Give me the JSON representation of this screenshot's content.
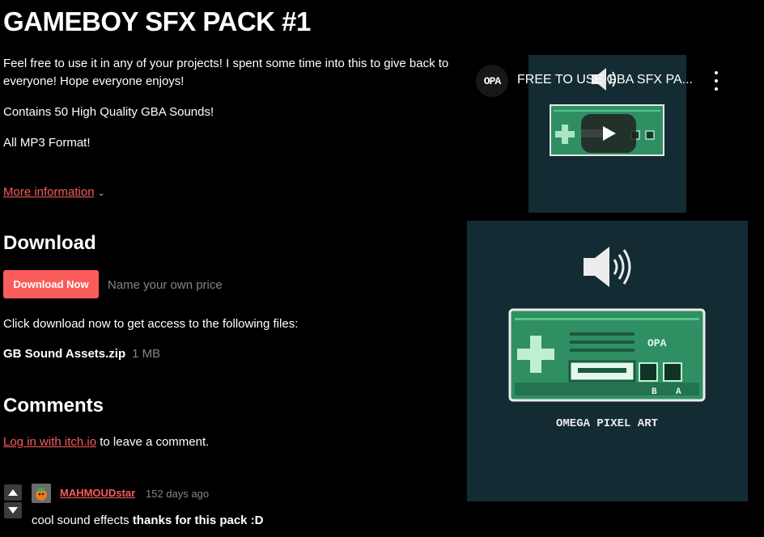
{
  "page": {
    "title": "GAMEBOY SFX PACK #1",
    "description": [
      "Feel free to use it in any of your projects! I spent some time into this to give back to everyone!  Hope everyone enjoys!",
      "Contains 50 High Quality GBA Sounds!",
      "All MP3 Format!"
    ],
    "more_info": "More information"
  },
  "download": {
    "heading": "Download",
    "button_label": "Download Now",
    "price_hint": "Name your own price",
    "files_intro": "Click download now to get access to the following files:",
    "files": [
      {
        "name": "GB Sound Assets.zip",
        "size": "1 MB"
      }
    ]
  },
  "comments": {
    "heading": "Comments",
    "login_link": "Log in with itch.io",
    "login_rest": " to leave a comment.",
    "items": [
      {
        "author": "MAHMOUDstar",
        "time": "152 days ago",
        "text_plain": "cool sound effects ",
        "text_bold": "thanks for this pack :D"
      }
    ]
  },
  "video": {
    "channel_logo": "OPA",
    "title": "FREE TO USE GBA SFX PA...",
    "icons": [
      "play-icon",
      "more-vert-icon",
      "speaker-icon"
    ]
  },
  "art": {
    "brand_text": "OMEGA PIXEL ART",
    "controller_label": "OPA",
    "button_labels": [
      "B",
      "A"
    ]
  },
  "colors": {
    "accent": "#fa5c5c",
    "background": "#000000",
    "muted": "#858585",
    "art_background": "#132c33",
    "controller_green": "#2f8f63"
  }
}
